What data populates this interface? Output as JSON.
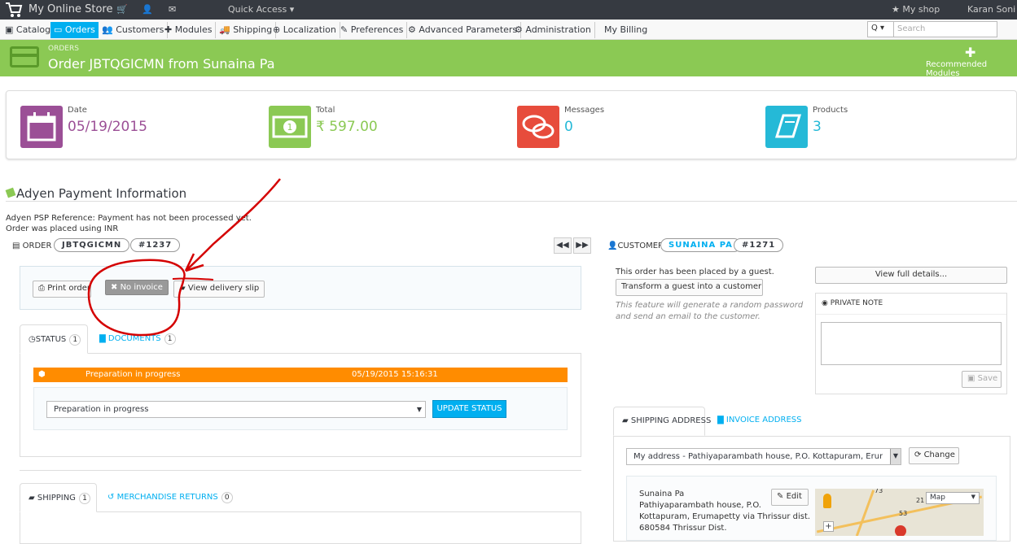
{
  "topbar": {
    "shop_name": "My Online Store",
    "quick_access": "Quick Access ▾",
    "my_shop": "My shop",
    "user_name": "Karan Soni"
  },
  "nav": {
    "items": [
      "Catalog",
      "Orders",
      "Customers",
      "Modules",
      "Shipping",
      "Localization",
      "Preferences",
      "Advanced Parameters",
      "Administration",
      "My Billing"
    ],
    "active": "Orders",
    "search_placeholder": "Search",
    "search_btn": "Q ▾"
  },
  "header": {
    "breadcrumb": "ORDERS",
    "title": "Order JBTQGICMN from Sunaina Pa",
    "recommended": "Recommended Modules",
    "accent": "#8bc954"
  },
  "kpis": [
    {
      "label": "Date",
      "value": "05/19/2015",
      "color": "#9b4f96",
      "icon": "calendar-icon"
    },
    {
      "label": "Total",
      "value": "₹ 597.00",
      "color": "#8bc954",
      "icon": "money-icon"
    },
    {
      "label": "Messages",
      "value": "0",
      "color": "#e74c3c",
      "icon": "chat-icon"
    },
    {
      "label": "Products",
      "value": "3",
      "color": "#25b9d7",
      "icon": "book-icon"
    }
  ],
  "adyen": {
    "title": "Adyen Payment Information",
    "psp": "Adyen PSP Reference: Payment has not been processed yet.",
    "currency": "Order was placed using INR"
  },
  "order": {
    "section_label": "ORDER",
    "reference": "JBTQGICMN",
    "id": "#1237",
    "buttons": {
      "print": "Print order",
      "no_invoice": "No invoice",
      "delivery": "View delivery slip"
    },
    "tabs": {
      "status": "STATUS",
      "status_count": "1",
      "documents": "DOCUMENTS",
      "documents_count": "1"
    },
    "history": {
      "status": "Preparation in progress",
      "date": "05/19/2015 15:16:31",
      "color": "#ff8c00"
    },
    "select_value": "Preparation in progress",
    "update_btn": "UPDATE STATUS",
    "tabs2": {
      "shipping": "SHIPPING",
      "shipping_count": "1",
      "returns": "MERCHANDISE RETURNS",
      "returns_count": "0"
    }
  },
  "customer": {
    "section_label": "CUSTOMER",
    "name": "SUNAINA PA",
    "id": "#1271",
    "guest_text": "This order has been placed by a guest.",
    "transform_btn": "Transform a guest into a customer",
    "hint": "This feature will generate a random password and send an email to the customer.",
    "view_details": "View full details...",
    "private_note": "PRIVATE NOTE",
    "save": "Save",
    "tabs": {
      "shipping": "SHIPPING ADDRESS",
      "invoice": "INVOICE ADDRESS"
    },
    "address_select": "My address - Pathiyaparambath house, P.O. Kottapuram, Eruma",
    "change": "Change",
    "edit": "Edit",
    "address_lines": [
      "Sunaina Pa",
      "Pathiyaparambath house, P.O.",
      "Kottapuram, Erumapetty via Thrissur dist.",
      "680584 Thrissur Dist."
    ],
    "map_type": "Map"
  }
}
